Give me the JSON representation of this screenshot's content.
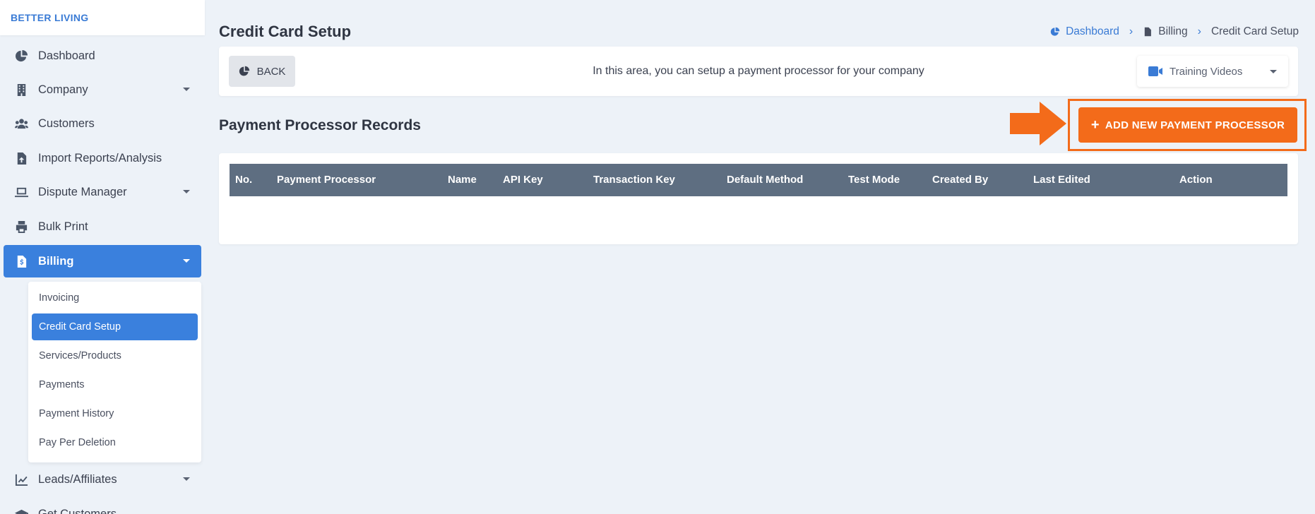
{
  "brand": "BETTER LIVING",
  "sidebar": {
    "items": [
      {
        "label": "Dashboard",
        "icon": "pie-chart-icon"
      },
      {
        "label": "Company",
        "icon": "building-icon"
      },
      {
        "label": "Customers",
        "icon": "users-icon"
      },
      {
        "label": "Import Reports/Analysis",
        "icon": "file-upload-icon"
      },
      {
        "label": "Dispute Manager",
        "icon": "laptop-icon"
      },
      {
        "label": "Bulk Print",
        "icon": "printer-icon"
      },
      {
        "label": "Billing",
        "icon": "invoice-icon"
      },
      {
        "label": "Leads/Affiliates",
        "icon": "chart-line-icon"
      },
      {
        "label": "Get Customers",
        "icon": "graduation-cap-icon"
      }
    ],
    "billing_submenu": [
      {
        "label": "Invoicing"
      },
      {
        "label": "Credit Card Setup"
      },
      {
        "label": "Services/Products"
      },
      {
        "label": "Payments"
      },
      {
        "label": "Payment History"
      },
      {
        "label": "Pay Per Deletion"
      }
    ]
  },
  "page": {
    "title": "Credit Card Setup",
    "breadcrumb": [
      "Dashboard",
      "Billing",
      "Credit Card Setup"
    ]
  },
  "top_card": {
    "back_label": "BACK",
    "info_text": "In this area, you can setup a payment processor for your company",
    "training_label": "Training Videos"
  },
  "records": {
    "title": "Payment Processor Records",
    "add_button_label": "ADD NEW PAYMENT PROCESSOR",
    "columns": [
      "No.",
      "Payment Processor",
      "Name",
      "API Key",
      "Transaction Key",
      "Default Method",
      "Test Mode",
      "Created By",
      "Last Edited",
      "Action"
    ],
    "rows": []
  },
  "colors": {
    "accent": "#3a80dd",
    "highlight": "#f36b1a",
    "table_header": "#5e6e81",
    "background": "#edf2f8"
  }
}
